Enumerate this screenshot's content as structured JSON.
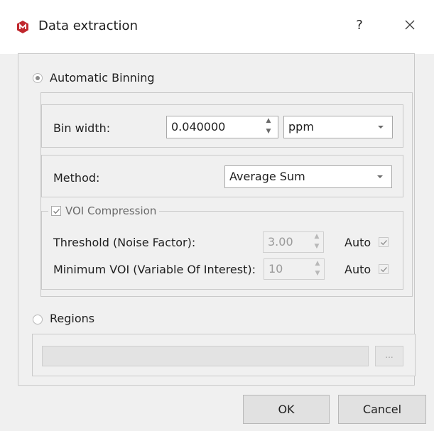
{
  "window": {
    "title": "Data extraction",
    "help_label": "?",
    "icon": "app-logo-icon",
    "close_icon": "close-icon"
  },
  "automatic_binning": {
    "label": "Automatic Binning",
    "selected": true,
    "bin_width": {
      "label": "Bin width:",
      "value": "0.040000",
      "unit": "ppm"
    },
    "method": {
      "label": "Method:",
      "value": "Average Sum"
    },
    "voi_compression": {
      "label": "VOI Compression",
      "checked": true,
      "threshold": {
        "label": "Threshold (Noise Factor):",
        "value": "3.00",
        "auto_label": "Auto",
        "auto_checked": true
      },
      "minimum_voi": {
        "label": "Minimum VOI (Variable Of Interest):",
        "value": "10",
        "auto_label": "Auto",
        "auto_checked": true
      }
    }
  },
  "regions": {
    "label": "Regions",
    "selected": false,
    "path_value": "",
    "browse_label": "..."
  },
  "buttons": {
    "ok": "OK",
    "cancel": "Cancel"
  },
  "colors": {
    "dialog_bg": "#f0f0f0",
    "brand": "#c0272d"
  }
}
